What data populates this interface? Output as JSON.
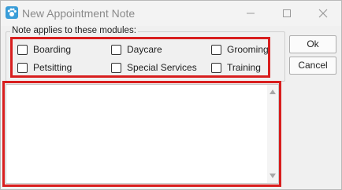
{
  "window": {
    "title": "New Appointment Note",
    "icon": "paw-app-icon",
    "controls": [
      "minimize-icon",
      "maximize-icon",
      "close-icon"
    ]
  },
  "modules": {
    "label": "Note applies to these modules:",
    "options": [
      {
        "label": "Boarding",
        "checked": false
      },
      {
        "label": "Daycare",
        "checked": false
      },
      {
        "label": "Grooming",
        "checked": false
      },
      {
        "label": "Petsitting",
        "checked": false
      },
      {
        "label": "Special Services",
        "checked": false
      },
      {
        "label": "Training",
        "checked": false
      }
    ]
  },
  "note": {
    "value": ""
  },
  "buttons": {
    "ok": "Ok",
    "cancel": "Cancel"
  },
  "colors": {
    "highlight": "#d81e1e",
    "app_icon": "#3a9dd8"
  }
}
